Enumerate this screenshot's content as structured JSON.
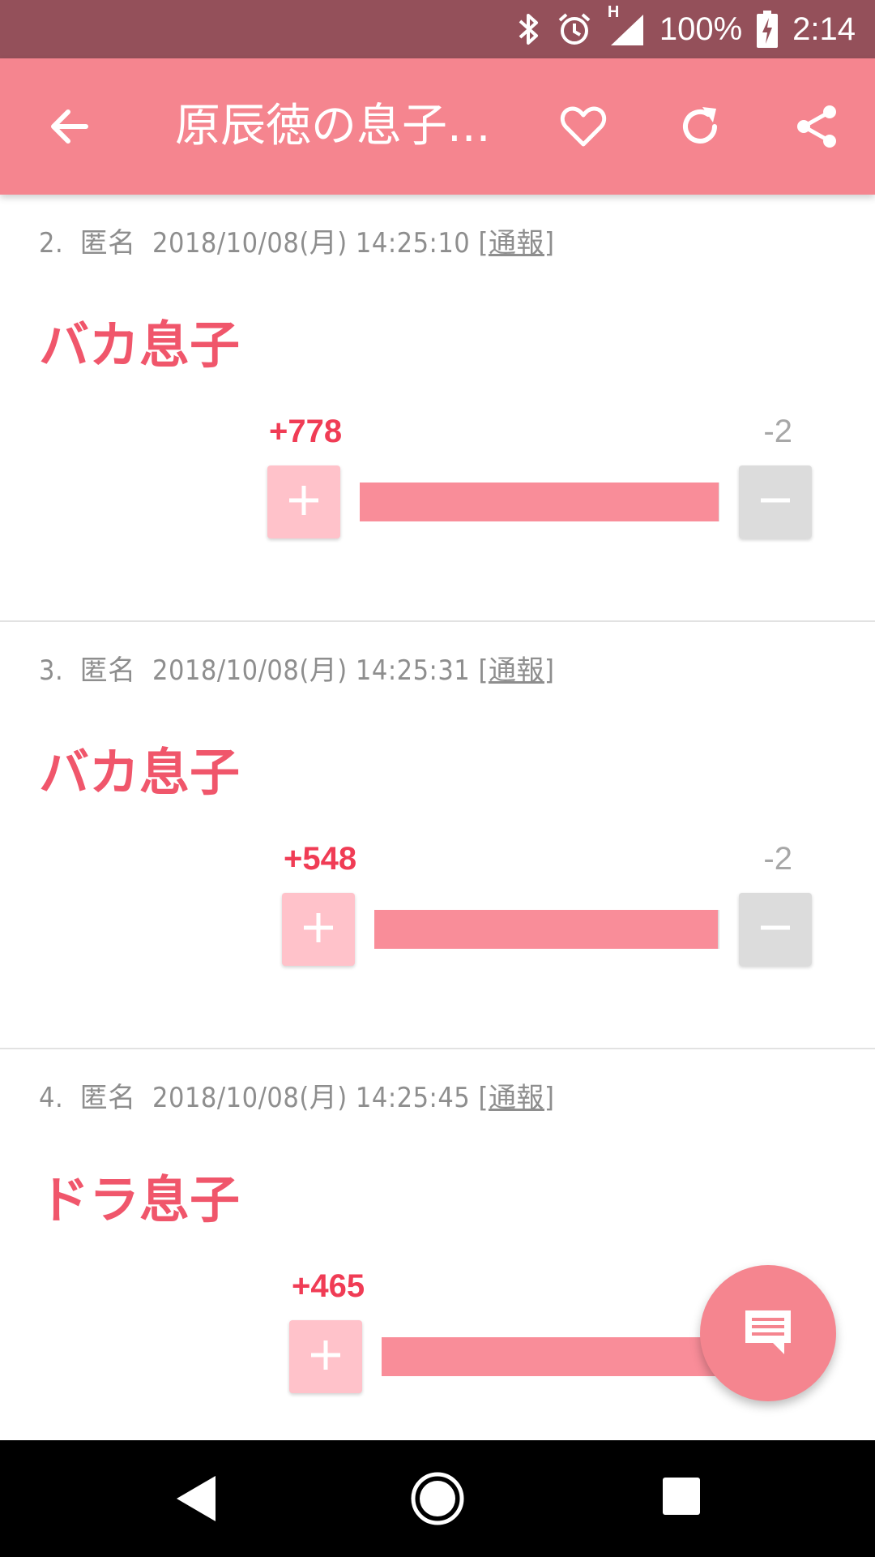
{
  "status_bar": {
    "network_label": "H",
    "battery": "100%",
    "time": "2:14",
    "icons": [
      "bluetooth-icon",
      "alarm-icon",
      "signal-icon",
      "battery-charging-icon"
    ]
  },
  "app_bar": {
    "title": "原辰徳の息子...",
    "icons": [
      "back-arrow-icon",
      "heart-icon",
      "refresh-icon",
      "share-icon"
    ]
  },
  "posts": [
    {
      "number": "2.",
      "author": "匿名",
      "datetime": "2018/10/08(月) 14:25:10",
      "report_label": "通報",
      "body": "バカ息子",
      "plus_count": "+778",
      "minus_count": "-2",
      "plus_ratio": 0.9974
    },
    {
      "number": "3.",
      "author": "匿名",
      "datetime": "2018/10/08(月) 14:25:31",
      "report_label": "通報",
      "body": "バカ息子",
      "plus_count": "+548",
      "minus_count": "-2",
      "plus_ratio": 0.9964
    },
    {
      "number": "4.",
      "author": "匿名",
      "datetime": "2018/10/08(月) 14:25:45",
      "report_label": "通報",
      "body": "ドラ息子",
      "plus_count": "+465",
      "minus_count": "",
      "plus_ratio": 1.0
    }
  ],
  "colors": {
    "status_bar": "#94505a",
    "app_bar": "#f5858f",
    "accent_text": "#f0566b",
    "plus_count": "#f03c55",
    "bar_fill": "#f98d99"
  },
  "fab": {
    "icon": "comment-icon"
  }
}
